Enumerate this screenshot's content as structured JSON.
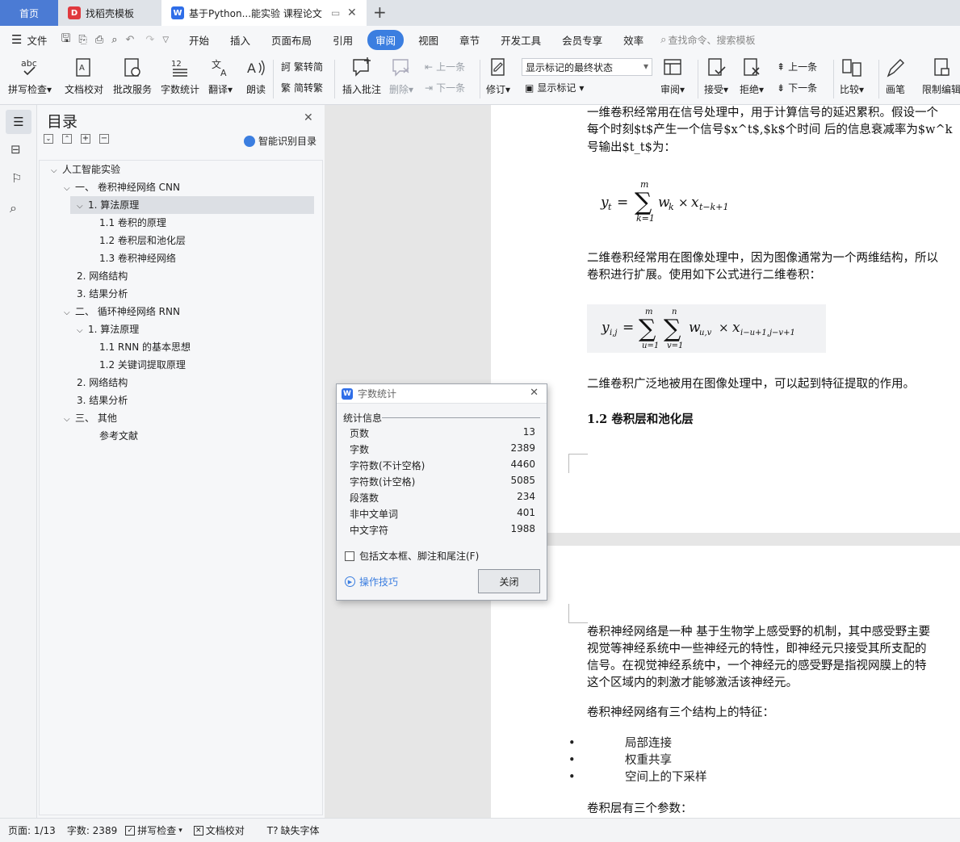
{
  "tabs": {
    "home": "首页",
    "templates": "找稻壳模板",
    "document": "基于Python...能实验 课程论文"
  },
  "menu": {
    "file": "文件",
    "items": [
      "开始",
      "插入",
      "页面布局",
      "引用",
      "审阅",
      "视图",
      "章节",
      "开发工具",
      "会员专享",
      "效率"
    ],
    "active": "审阅",
    "search_placeholder": "查找命令、搜索模板"
  },
  "ribbon": {
    "spell_check": "拼写检查",
    "doc_proof": "文档校对",
    "batch_service": "批改服务",
    "word_count": "字数统计",
    "translate": "翻译",
    "read_aloud": "朗读",
    "trad_to_simp": "繁转简",
    "simp_to_trad": "简转繁",
    "insert_comment": "插入批注",
    "delete": "删除",
    "prev_comment": "上一条",
    "next_comment": "下一条",
    "track_changes": "修订",
    "markup_state": "显示标记的最终状态",
    "show_markup": "显示标记",
    "review": "审阅",
    "accept": "接受",
    "reject": "拒绝",
    "prev_change": "上一条",
    "next_change": "下一条",
    "compare": "比较",
    "pen": "画笔",
    "restrict_edit": "限制编辑"
  },
  "toc": {
    "title": "目录",
    "smart_recognize": "智能识别目录",
    "items": [
      {
        "label": "人工智能实验",
        "level": 0,
        "expanded": true
      },
      {
        "label": "一、  卷积神经网络 CNN",
        "level": 1,
        "expanded": true
      },
      {
        "label": "1. 算法原理",
        "level": 2,
        "expanded": true,
        "selected": true
      },
      {
        "label": "1.1  卷积的原理",
        "level": 3
      },
      {
        "label": "1.2  卷积层和池化层",
        "level": 3
      },
      {
        "label": "1.3  卷积神经网络",
        "level": 3
      },
      {
        "label": "2. 网络结构",
        "level": 2
      },
      {
        "label": "3. 结果分析",
        "level": 2
      },
      {
        "label": "二、  循环神经网络 RNN",
        "level": 1,
        "expanded": true
      },
      {
        "label": "1. 算法原理",
        "level": 2,
        "expanded": true
      },
      {
        "label": "1.1 RNN 的基本思想",
        "level": 3
      },
      {
        "label": "1.2  关键词提取原理",
        "level": 3
      },
      {
        "label": "2. 网络结构",
        "level": 2
      },
      {
        "label": "3. 结果分析",
        "level": 2
      },
      {
        "label": "三、  其他",
        "level": 1,
        "expanded": true
      },
      {
        "label": "参考文献",
        "level": 3
      }
    ]
  },
  "document": {
    "p1_l1": "一维卷积经常用在信号处理中，用于计算信号的延迟累积。假设一个",
    "p1_l2": "每个时刻$t$产生一个信号$x^t$,$k$个时间  后的信息衰减率为$w^k",
    "p1_l3": "号输出$t_t$为：",
    "p2_l1": "二维卷积经常用在图像处理中，因为图像通常为一个两维结构，所以",
    "p2_l2": "卷积进行扩展。使用如下公式进行二维卷积：",
    "p3": "二维卷积广泛地被用在图像处理中，可以起到特征提取的作用。",
    "heading": "1.2  卷积层和池化层",
    "p4_l1": "卷积神经网络是一种  基于生物学上感受野的机制，其中感受野主要",
    "p4_l2": "视觉等神经系统中一些神经元的特性，即神经元只接受其所支配的",
    "p4_l3": "信号。在视觉神经系统中，一个神经元的感受野是指视网膜上的特",
    "p4_l4": "这个区域内的刺激才能够激活该神经元。",
    "p5": "卷积神经网络有三个结构上的特征：",
    "bullets": [
      "局部连接",
      "权重共享",
      "空间上的下采样"
    ],
    "p6": "卷积层有三个参数："
  },
  "dialog": {
    "title": "字数统计",
    "section": "统计信息",
    "stats": [
      {
        "label": "页数",
        "value": "13"
      },
      {
        "label": "字数",
        "value": "2389"
      },
      {
        "label": "字符数(不计空格)",
        "value": "4460"
      },
      {
        "label": "字符数(计空格)",
        "value": "5085"
      },
      {
        "label": "段落数",
        "value": "234"
      },
      {
        "label": "非中文单词",
        "value": "401"
      },
      {
        "label": "中文字符",
        "value": "1988"
      }
    ],
    "checkbox": "包括文本框、脚注和尾注(F)",
    "tips": "操作技巧",
    "close": "关闭"
  },
  "status": {
    "page": "页面: 1/13",
    "words": "字数: 2389",
    "spell": "拼写检查",
    "proof": "文档校对",
    "missing_font": "缺失字体"
  }
}
